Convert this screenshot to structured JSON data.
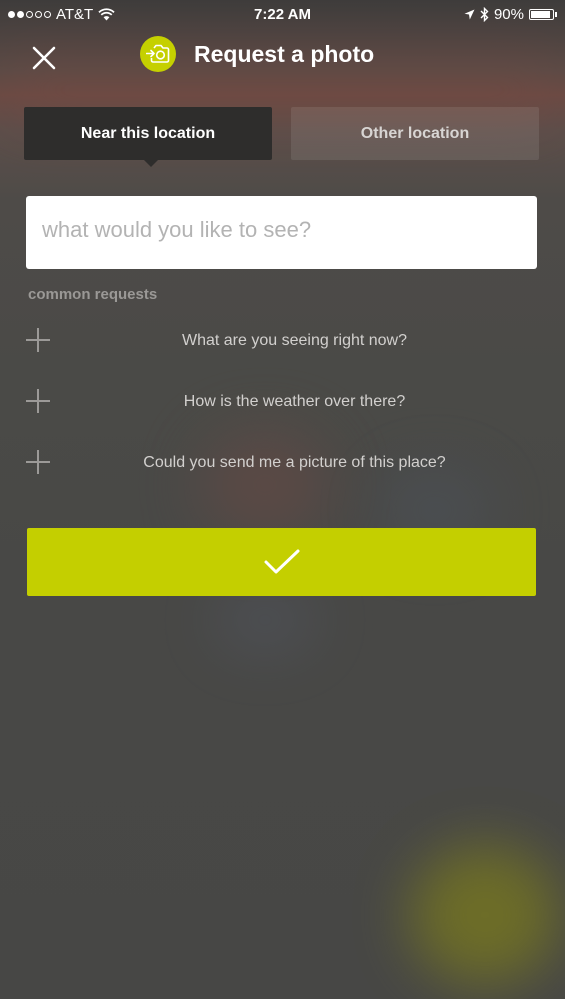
{
  "status_bar": {
    "carrier": "AT&T",
    "time": "7:22 AM",
    "battery": "90%",
    "battery_level": 0.9,
    "signal_bars": 2
  },
  "header": {
    "title": "Request a photo",
    "close_icon": "close-icon",
    "badge_icon": "camera-request-icon",
    "accent_color": "#c5d000"
  },
  "tabs": [
    {
      "label": "Near this location",
      "active": true
    },
    {
      "label": "Other location",
      "active": false
    }
  ],
  "request_input": {
    "value": "",
    "placeholder": "what would you like to see?"
  },
  "common_requests": {
    "label": "common requests",
    "items": [
      {
        "label": "What are you seeing right now?",
        "icon": "plus-icon"
      },
      {
        "label": "How is the weather over there?",
        "icon": "plus-icon"
      },
      {
        "label": "Could you send me a picture of this place?",
        "icon": "plus-icon"
      }
    ]
  },
  "submit": {
    "icon": "checkmark-icon",
    "color": "#c4cf00"
  }
}
